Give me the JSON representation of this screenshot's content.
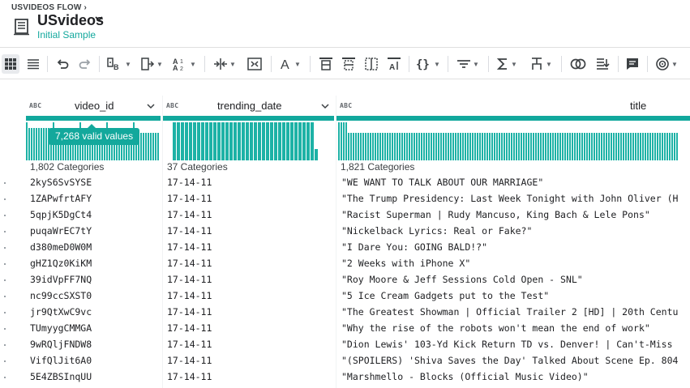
{
  "header": {
    "breadcrumb": "USVIDEOS FLOW",
    "title": "USvideos",
    "subtitle": "Initial Sample"
  },
  "toolbar": {
    "icons": [
      "grid-view-icon",
      "list-view-icon",
      "undo-icon",
      "redo-icon",
      "change-type-icon",
      "format-icon",
      "sort-icon",
      "merge-columns-icon",
      "split-columns-icon",
      "text-icon",
      "filter-rows-icon",
      "replace-icon",
      "extract-icon",
      "count-icon",
      "nested-icon",
      "filter-icon",
      "aggregate-icon",
      "pivot-icon",
      "join-icon",
      "union-icon",
      "comment-icon",
      "more-icon"
    ]
  },
  "columns": [
    {
      "type": "ABC",
      "name": "video_id",
      "categories": "1,802 Categories"
    },
    {
      "type": "ABC",
      "name": "trending_date",
      "categories": "37 Categories"
    },
    {
      "type": "ABC",
      "name": "title",
      "categories": "1,821 Categories"
    }
  ],
  "tooltip": "7,268 valid values",
  "rows": [
    {
      "video_id": "2kyS6SvSYSE",
      "trending_date": "17-14-11",
      "title": "\"WE WANT TO TALK ABOUT OUR MARRIAGE\""
    },
    {
      "video_id": "1ZAPwfrtAFY",
      "trending_date": "17-14-11",
      "title": "\"The Trump Presidency: Last Week Tonight with John Oliver (H"
    },
    {
      "video_id": "5qpjK5DgCt4",
      "trending_date": "17-14-11",
      "title": "\"Racist Superman | Rudy Mancuso, King Bach & Lele Pons\""
    },
    {
      "video_id": "puqaWrEC7tY",
      "trending_date": "17-14-11",
      "title": "\"Nickelback Lyrics: Real or Fake?\""
    },
    {
      "video_id": "d380meD0W0M",
      "trending_date": "17-14-11",
      "title": "\"I Dare You: GOING BALD!?\""
    },
    {
      "video_id": "gHZ1Qz0KiKM",
      "trending_date": "17-14-11",
      "title": "\"2 Weeks with iPhone X\""
    },
    {
      "video_id": "39idVpFF7NQ",
      "trending_date": "17-14-11",
      "title": "\"Roy Moore & Jeff Sessions Cold Open - SNL\""
    },
    {
      "video_id": "nc99ccSXST0",
      "trending_date": "17-14-11",
      "title": "\"5 Ice Cream Gadgets put to the Test\""
    },
    {
      "video_id": "jr9QtXwC9vc",
      "trending_date": "17-14-11",
      "title": "\"The Greatest Showman | Official Trailer 2 [HD] | 20th Centu"
    },
    {
      "video_id": "TUmyygCMMGA",
      "trending_date": "17-14-11",
      "title": "\"Why the rise of the robots won't mean the end of work\""
    },
    {
      "video_id": "9wRQljFNDW8",
      "trending_date": "17-14-11",
      "title": "\"Dion Lewis' 103-Yd Kick Return TD vs. Denver! | Can't-Miss"
    },
    {
      "video_id": "VifQlJit6A0",
      "trending_date": "17-14-11",
      "title": "\"(SPOILERS) 'Shiva Saves the Day' Talked About Scene Ep. 804"
    },
    {
      "video_id": "5E4ZBSInqUU",
      "trending_date": "17-14-11",
      "title": "\"Marshmello - Blocks (Official Music Video)\""
    }
  ],
  "colors": {
    "accent": "#12a89d",
    "bar": "#1db2a6"
  }
}
